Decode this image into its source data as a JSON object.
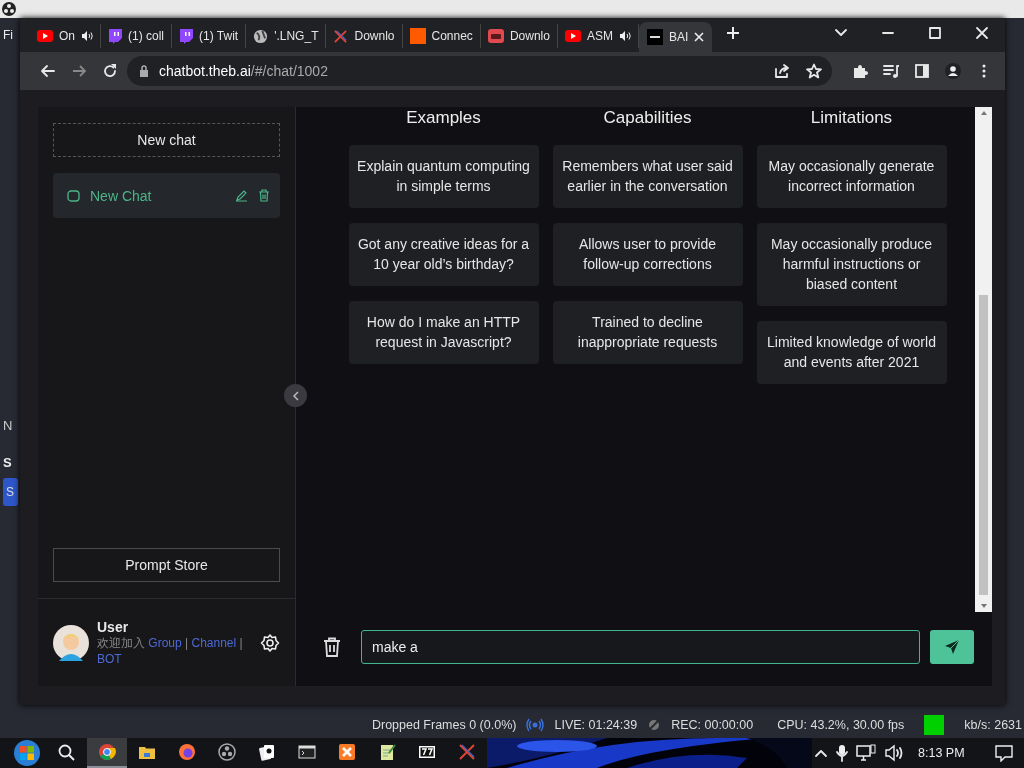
{
  "background_app": {
    "menu_fragment": "Fi",
    "side_fragments": [
      "N",
      "S"
    ],
    "side_button": "S",
    "status_bar": {
      "dropped_frames": "Dropped Frames 0 (0.0%)",
      "live": "LIVE: 01:24:39",
      "rec": "REC: 00:00:00",
      "cpu": "CPU: 43.2%, 30.00 fps",
      "bitrate": "kb/s: 2631"
    }
  },
  "browser": {
    "tabs": [
      {
        "title": "On",
        "kind": "youtube",
        "audio": true,
        "selected": false
      },
      {
        "title": "(1) coll",
        "kind": "twitch",
        "audio": false,
        "selected": false
      },
      {
        "title": "(1) Twit",
        "kind": "twitch",
        "audio": false,
        "selected": false
      },
      {
        "title": "'.LNG_T",
        "kind": "globe",
        "audio": false,
        "selected": false
      },
      {
        "title": "Downlo",
        "kind": "swords",
        "audio": false,
        "selected": false
      },
      {
        "title": "Connec",
        "kind": "square",
        "audio": false,
        "selected": false
      },
      {
        "title": "Downlo",
        "kind": "arcade",
        "audio": false,
        "selected": false
      },
      {
        "title": "ASM",
        "kind": "youtube",
        "audio": true,
        "selected": false
      },
      {
        "title": "BAI",
        "kind": "bai",
        "audio": false,
        "selected": true
      }
    ],
    "address": {
      "host": "chatbot.theb.ai",
      "path": "/#/chat/1002"
    }
  },
  "sidebar": {
    "new_chat": "New chat",
    "chats": [
      {
        "title": "New Chat",
        "selected": true
      }
    ],
    "prompt_store": "Prompt Store",
    "user": {
      "name": "User",
      "welcome": "欢迎加入",
      "links": [
        "Group",
        "Channel",
        "BOT"
      ],
      "separator": "|"
    }
  },
  "columns": [
    {
      "heading": "Examples",
      "cards": [
        "Explain quantum computing in simple terms",
        "Got any creative ideas for a 10 year old’s birthday?",
        "How do I make an HTTP request in Javascript?"
      ]
    },
    {
      "heading": "Capabilities",
      "cards": [
        "Remembers what user said earlier in the conversation",
        "Allows user to provide follow-up corrections",
        "Trained to decline inappropriate requests"
      ]
    },
    {
      "heading": "Limitations",
      "cards": [
        "May occasionally generate incorrect information",
        "May occasionally produce harmful instructions or biased content",
        "Limited knowledge of world and events after 2021"
      ]
    }
  ],
  "composer": {
    "value": "make a"
  },
  "taskbar": {
    "apps": [
      {
        "kind": "chrome",
        "selected": true
      },
      {
        "kind": "folder",
        "selected": false
      },
      {
        "kind": "firefox",
        "selected": false
      },
      {
        "kind": "obs",
        "selected": false
      },
      {
        "kind": "cards",
        "selected": false
      },
      {
        "kind": "terminal",
        "selected": false
      },
      {
        "kind": "xampp",
        "selected": false
      },
      {
        "kind": "notepad",
        "selected": false
      },
      {
        "kind": "sevenzip",
        "selected": false
      },
      {
        "kind": "swords",
        "selected": false
      }
    ],
    "clock": "8:13 PM"
  }
}
